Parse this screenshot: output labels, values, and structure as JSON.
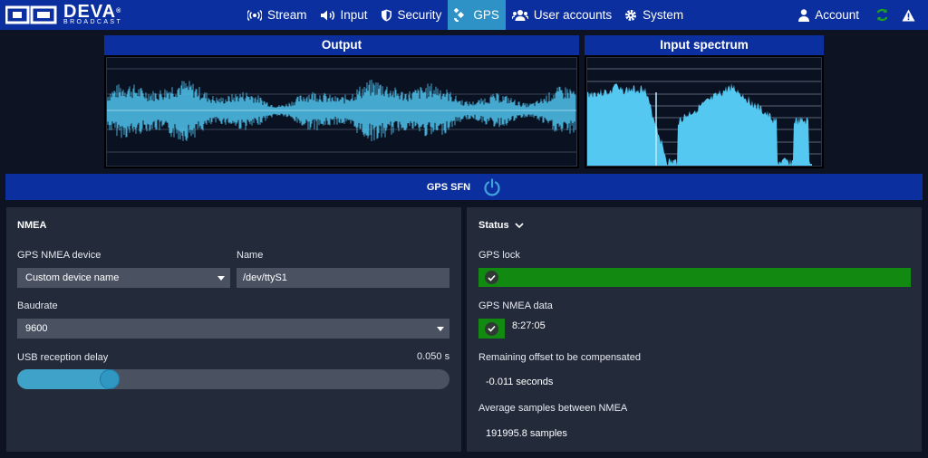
{
  "brand": {
    "name": "DEVA",
    "sub": "BROADCAST",
    "reg": "®"
  },
  "nav": [
    {
      "label": "Stream",
      "icon": "broadcast-icon",
      "active": false
    },
    {
      "label": "Input",
      "icon": "speaker-icon",
      "active": false
    },
    {
      "label": "Security",
      "icon": "shield-icon",
      "active": false
    },
    {
      "label": "GPS",
      "icon": "satellite-icon",
      "active": true
    },
    {
      "label": "User accounts",
      "icon": "users-icon",
      "active": false
    },
    {
      "label": "System",
      "icon": "gear-icon",
      "active": false
    }
  ],
  "account": {
    "label": "Account",
    "icon": "user-icon"
  },
  "status_icons": {
    "sync": "sync-icon",
    "alert": "warning-icon",
    "sync_color": "#1ea21e"
  },
  "output_panel": {
    "title": "Output"
  },
  "spectrum_panel": {
    "title": "Input spectrum"
  },
  "sfn": {
    "label": "GPS SFN",
    "icon": "power-icon"
  },
  "nmea": {
    "title": "NMEA",
    "device_label": "GPS NMEA device",
    "device_value": "Custom device name",
    "name_label": "Name",
    "name_value": "/dev/ttyS1",
    "baud_label": "Baudrate",
    "baud_value": "9600",
    "delay_label": "USB reception delay",
    "delay_value": "0.050 s",
    "delay_fraction": 0.12
  },
  "status": {
    "title": "Status",
    "gps_lock_label": "GPS lock",
    "gps_nmea_label": "GPS NMEA data",
    "gps_nmea_time": "8:27:05",
    "remaining_label": "Remaining offset to be compensated",
    "remaining_value": "-0.011 seconds",
    "avg_label": "Average samples between NMEA",
    "avg_value": "191995.8 samples"
  },
  "colors": {
    "topbar": "#0b2f9e",
    "active_tab": "#2e92c6",
    "ok": "#128a12",
    "wave": "#4fc3ee",
    "card": "#232b3b"
  }
}
